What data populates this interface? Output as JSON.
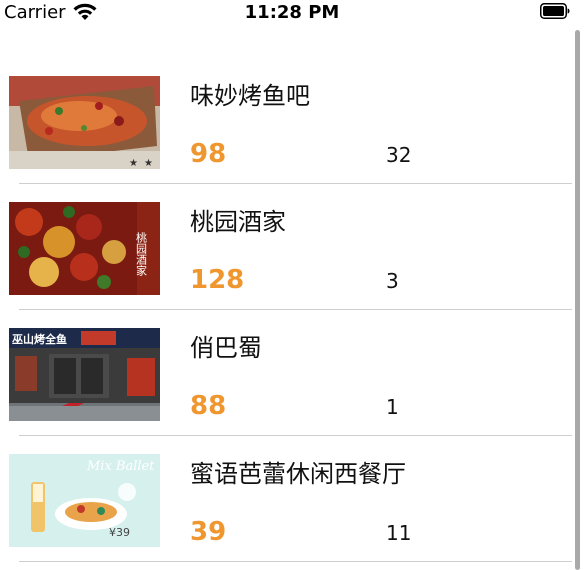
{
  "status_bar": {
    "carrier": "Carrier",
    "time": "11:28 PM",
    "icons": [
      "wifi-icon",
      "battery-icon"
    ]
  },
  "accent_color": "#f0962e",
  "restaurants": [
    {
      "name": "味妙烤鱼吧",
      "price": "98",
      "count": "32",
      "image": "grilled-fish-photo"
    },
    {
      "name": "桃园酒家",
      "price": "128",
      "count": "3",
      "image": "spicy-chicken-photo",
      "image_text": "桃园酒家"
    },
    {
      "name": "俏巴蜀",
      "price": "88",
      "count": "1",
      "image": "storefront-photo",
      "image_text": "巫山烤全鱼"
    },
    {
      "name": "蜜语芭蕾休闲西餐厅",
      "price": "39",
      "count": "11",
      "image": "western-menu-photo",
      "image_text": "Mix Ballet",
      "image_price": "¥39"
    }
  ]
}
